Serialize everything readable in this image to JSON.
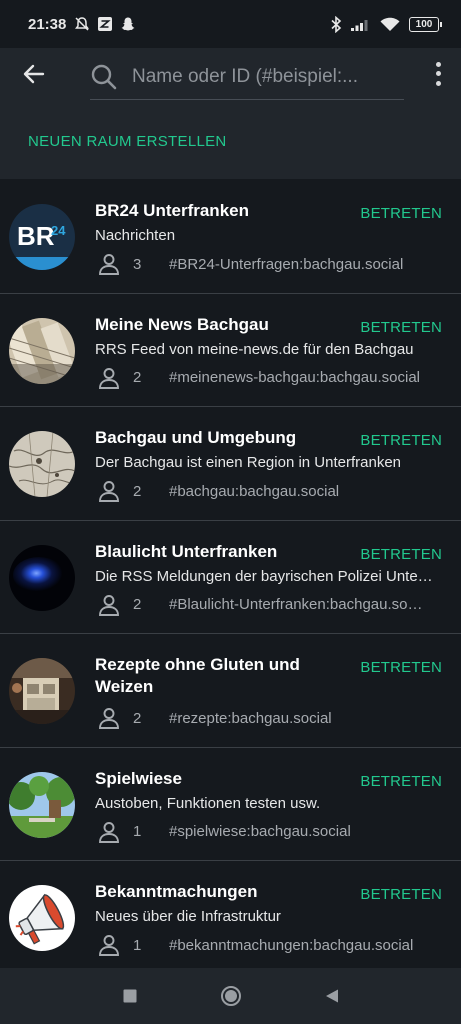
{
  "status_bar": {
    "time": "21:38",
    "left_icons": [
      "silent-bell-icon",
      "app-notification-icon",
      "snapchat-icon"
    ],
    "right_icons": [
      "bluetooth-icon",
      "signal-icon",
      "wifi-icon"
    ],
    "battery": "100"
  },
  "header": {
    "search_placeholder": "Name oder ID (#beispiel:...",
    "create_room_label": "NEUEN RAUM ERSTELLEN"
  },
  "rooms": [
    {
      "name": "BR24 Unterfranken",
      "description": "Nachrichten",
      "members": "3",
      "alias": "#BR24-Unterfragen:bachgau.social",
      "join_label": "BETRETEN",
      "avatar": "br24-logo"
    },
    {
      "name": "Meine News Bachgau",
      "description": "RRS Feed von meine-news.de für den Bachgau",
      "members": "2",
      "alias": "#meinenews-bachgau:bachgau.social",
      "join_label": "BETRETEN",
      "avatar": "newspapers-photo"
    },
    {
      "name": "Bachgau und Umgebung",
      "description": "Der Bachgau ist einen Region in Unterfranken",
      "members": "2",
      "alias": "#bachgau:bachgau.social",
      "join_label": "BETRETEN",
      "avatar": "old-map-photo"
    },
    {
      "name": "Blaulicht Unterfranken",
      "description": "Die RSS Meldungen der bayrischen Polizei Unterfranken",
      "members": "2",
      "alias": "#Blaulicht-Unterfranken:bachgau.social",
      "join_label": "BETRETEN",
      "avatar": "blue-light-photo"
    },
    {
      "name": "Rezepte ohne Gluten und Weizen",
      "description": "",
      "members": "2",
      "alias": "#rezepte:bachgau.social",
      "join_label": "BETRETEN",
      "avatar": "kitchen-photo"
    },
    {
      "name": "Spielwiese",
      "description": "Austoben, Funktionen testen usw.",
      "members": "1",
      "alias": "#spielwiese:bachgau.social",
      "join_label": "BETRETEN",
      "avatar": "park-photo"
    },
    {
      "name": "Bekanntmachungen",
      "description": "Neues über die Infrastruktur",
      "members": "1",
      "alias": "#bekanntmachungen:bachgau.social",
      "join_label": "BETRETEN",
      "avatar": "megaphone-icon"
    }
  ],
  "nav_bar": {
    "icons": [
      "recents-square-icon",
      "home-circle-icon",
      "back-triangle-icon"
    ]
  },
  "colors": {
    "accent": "#22c88e",
    "background": "#15191e",
    "header_bg": "#21262c",
    "divider": "#3a3f45"
  }
}
